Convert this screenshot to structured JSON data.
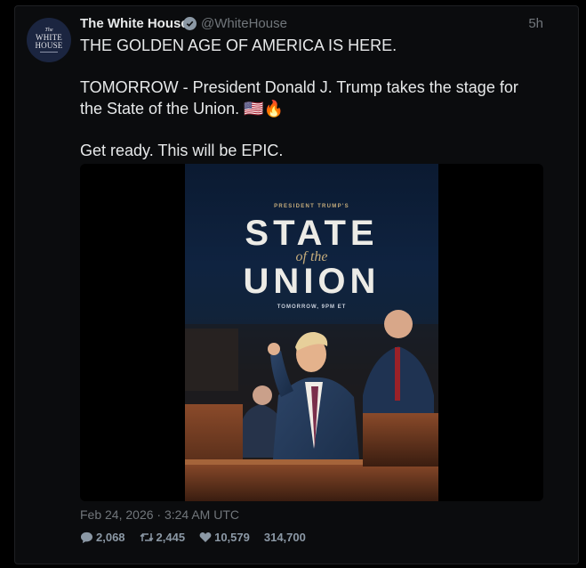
{
  "tweet": {
    "avatar": {
      "line1": "The",
      "line2": "WHITE",
      "line3": "HOUSE"
    },
    "name": "The White House",
    "handle": "@WhiteHouse",
    "time": "5h",
    "text": "THE GOLDEN AGE OF AMERICA IS HERE.\n\nTOMORROW - President Donald J. Trump takes the stage for the State of the Union. 🇺🇸🔥\n\nGet ready. This will be EPIC.",
    "timestamp": "Feb 24, 2026 · 3:24 AM UTC"
  },
  "poster": {
    "eyebrow": "PRESIDENT TRUMP'S",
    "title_line1": "STATE",
    "title_connector": "of the",
    "title_line2": "UNION",
    "when": "TOMORROW, 9PM ET"
  },
  "stats": {
    "replies": "2,068",
    "retweets": "2,445",
    "likes": "10,579",
    "views": "314,700"
  },
  "icons": {
    "verified": "verified-badge-icon",
    "reply": "speech-bubble-icon",
    "retweet": "retweet-arrows-icon",
    "like": "heart-icon"
  }
}
